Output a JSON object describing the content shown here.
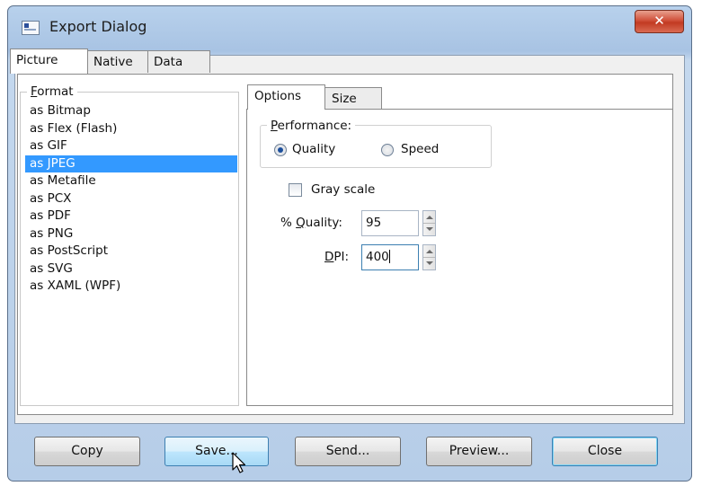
{
  "window": {
    "title": "Export Dialog",
    "close_glyph": "✕"
  },
  "outer_tabs": [
    "Picture",
    "Native",
    "Data"
  ],
  "format": {
    "legend_underline": "F",
    "legend_rest": "ormat",
    "items": [
      "as Bitmap",
      "as Flex (Flash)",
      "as GIF",
      "as JPEG",
      "as Metafile",
      "as PCX",
      "as PDF",
      "as PNG",
      "as PostScript",
      "as SVG",
      "as XAML (WPF)"
    ],
    "selected_index": 3
  },
  "inner_tabs": [
    "Options",
    "Size"
  ],
  "performance": {
    "legend_underline": "P",
    "legend_rest": "erformance:",
    "quality_label": "Quality",
    "speed_label": "Speed",
    "selected": "Quality"
  },
  "grayscale": {
    "label": "Gray scale",
    "checked": false
  },
  "quality": {
    "label_prefix": "% ",
    "label_underline": "Q",
    "label_rest": "uality:",
    "value": "95"
  },
  "dpi": {
    "label_underline": "D",
    "label_rest": "PI:",
    "value": "400"
  },
  "buttons": {
    "copy": "Copy",
    "save": "Save...",
    "send": "Send...",
    "preview": "Preview...",
    "close": "Close"
  },
  "colors": {
    "selection": "#3399ff",
    "title_gradient": "#b8d1ec",
    "close_button": "#c23a22"
  },
  "icons": {
    "window": "dialog-window-icon",
    "radio": "radio-button",
    "cursor": "arrow-pointer-icon"
  }
}
